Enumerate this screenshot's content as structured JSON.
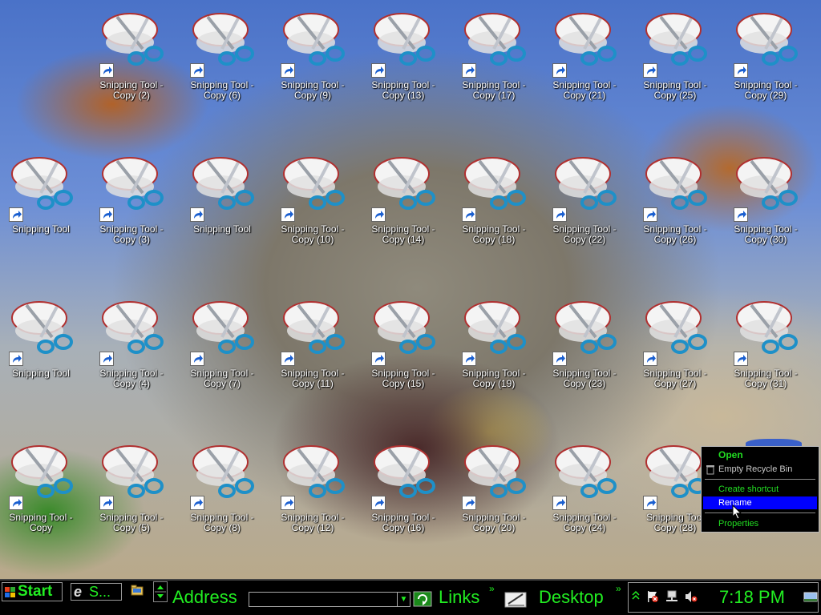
{
  "desktop": {
    "icons": [
      {
        "line1": "Snipping Tool -",
        "line2": "Copy (2)"
      },
      {
        "line1": "Snipping Tool -",
        "line2": "Copy (6)"
      },
      {
        "line1": "Snipping Tool -",
        "line2": "Copy (9)"
      },
      {
        "line1": "Snipping Tool -",
        "line2": "Copy (13)"
      },
      {
        "line1": "Snipping Tool -",
        "line2": "Copy (17)"
      },
      {
        "line1": "Snipping Tool -",
        "line2": "Copy (21)"
      },
      {
        "line1": "Snipping Tool -",
        "line2": "Copy (25)"
      },
      {
        "line1": "Snipping Tool -",
        "line2": "Copy (29)"
      },
      {
        "line1": "Snipping Tool",
        "line2": ""
      },
      {
        "line1": "Snipping Tool -",
        "line2": "Copy (3)"
      },
      {
        "line1": "Snipping Tool",
        "line2": ""
      },
      {
        "line1": "Snipping Tool -",
        "line2": "Copy (10)"
      },
      {
        "line1": "Snipping Tool -",
        "line2": "Copy (14)"
      },
      {
        "line1": "Snipping Tool -",
        "line2": "Copy (18)"
      },
      {
        "line1": "Snipping Tool -",
        "line2": "Copy (22)"
      },
      {
        "line1": "Snipping Tool -",
        "line2": "Copy (26)"
      },
      {
        "line1": "Snipping Tool -",
        "line2": "Copy (30)"
      },
      {
        "line1": "Snipping Tool",
        "line2": ""
      },
      {
        "line1": "Snipping Tool -",
        "line2": "Copy (4)"
      },
      {
        "line1": "Snipping Tool -",
        "line2": "Copy (7)"
      },
      {
        "line1": "Snipping Tool -",
        "line2": "Copy (11)"
      },
      {
        "line1": "Snipping Tool -",
        "line2": "Copy (15)"
      },
      {
        "line1": "Snipping Tool -",
        "line2": "Copy (19)"
      },
      {
        "line1": "Snipping Tool -",
        "line2": "Copy (23)"
      },
      {
        "line1": "Snipping Tool -",
        "line2": "Copy (27)"
      },
      {
        "line1": "Snipping Tool -",
        "line2": "Copy (31)"
      },
      {
        "line1": "Snipping Tool -",
        "line2": "Copy"
      },
      {
        "line1": "Snipping Tool -",
        "line2": "Copy (5)"
      },
      {
        "line1": "Snipping Tool -",
        "line2": "Copy (8)"
      },
      {
        "line1": "Snipping Tool -",
        "line2": "Copy (12)"
      },
      {
        "line1": "Snipping Tool -",
        "line2": "Copy (16)"
      },
      {
        "line1": "Snipping Tool -",
        "line2": "Copy (20)"
      },
      {
        "line1": "Snipping Tool -",
        "line2": "Copy (24)"
      },
      {
        "line1": "Snipping Tool",
        "line2": "Copy (28)"
      }
    ]
  },
  "context_menu": {
    "open": "Open",
    "empty_recycle_bin": "Empty Recycle Bin",
    "create_shortcut": "Create shortcut",
    "rename": "Rename",
    "properties": "Properties"
  },
  "taskbar": {
    "start_label": "Start",
    "ie_task_label": "S...",
    "address_label": "Address",
    "address_value": "",
    "links_label": "Links",
    "desktop_label": "Desktop",
    "chevron": "»",
    "clock": "7:18 PM"
  },
  "colors": {
    "taskbar_bg": "#000000",
    "taskbar_text": "#22ee22",
    "menu_highlight": "#0000ff"
  }
}
